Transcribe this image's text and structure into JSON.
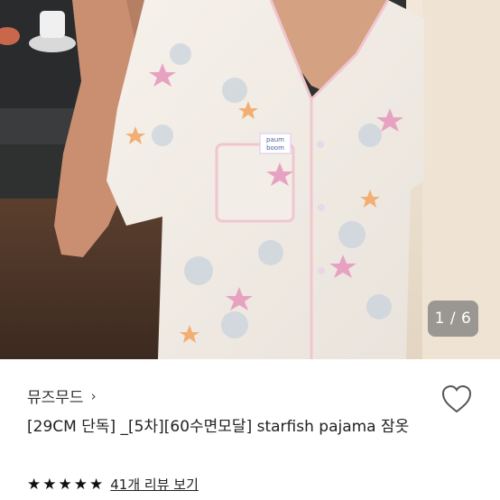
{
  "gallery": {
    "page_indicator": "1 / 6"
  },
  "product": {
    "brand_name": "뮤즈무드",
    "brand_chevron": "›",
    "title": "[29CM 단독] _[5차][60수면모달] starfish pajama 잠옷",
    "rating_stars": 5,
    "reviews_link": "41개 리뷰 보기"
  },
  "icons": {
    "wishlist": "heart-outline-icon",
    "star": "star-icon"
  },
  "colors": {
    "pager_bg": "#787878",
    "text": "#222222",
    "star": "#111111"
  }
}
